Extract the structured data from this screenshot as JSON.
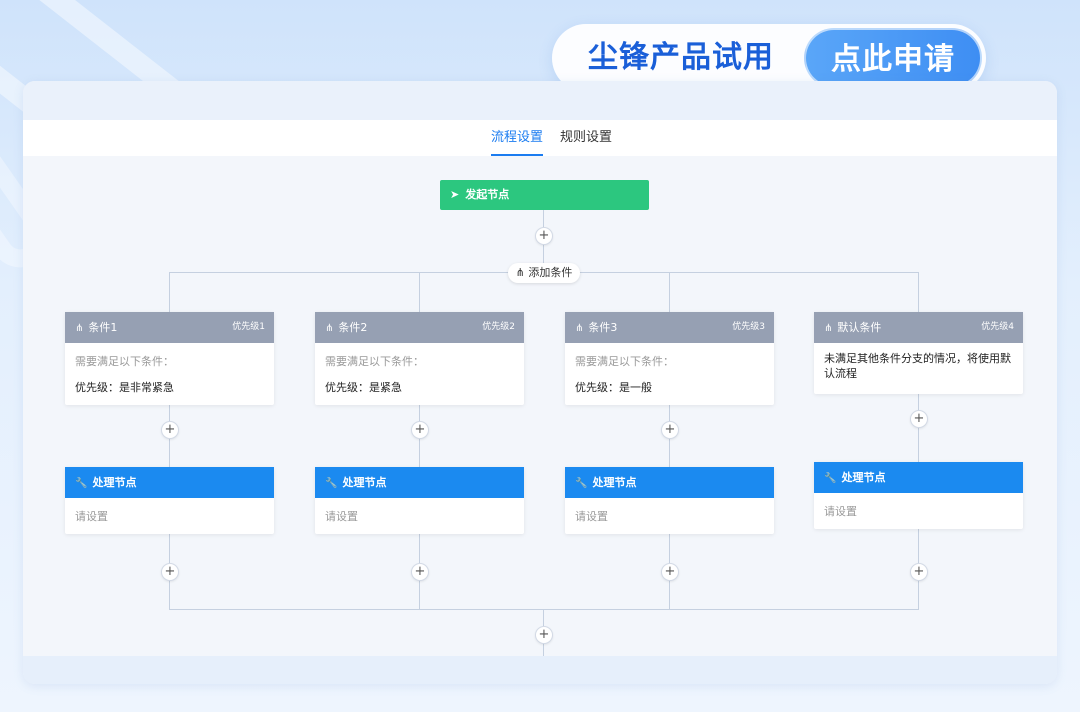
{
  "banner": {
    "text": "尘锋产品试用",
    "button": "点此申请"
  },
  "tabs": [
    {
      "label": "流程设置",
      "active": true
    },
    {
      "label": "规则设置",
      "active": false
    }
  ],
  "flow": {
    "start_label": "发起节点",
    "add_condition_label": "添加条件",
    "plus": "+",
    "conditions": [
      {
        "title": "条件1",
        "priority": "优先级1",
        "sub": "需要满足以下条件：",
        "main": "优先级：是非常紧急"
      },
      {
        "title": "条件2",
        "priority": "优先级2",
        "sub": "需要满足以下条件：",
        "main": "优先级：是紧急"
      },
      {
        "title": "条件3",
        "priority": "优先级3",
        "sub": "需要满足以下条件：",
        "main": "优先级：是一般"
      },
      {
        "title": "默认条件",
        "priority": "优先级4",
        "sub": "",
        "main": "未满足其他条件分支的情况，将使用默认流程"
      }
    ],
    "process": [
      {
        "title": "处理节点",
        "hint": "请设置"
      },
      {
        "title": "处理节点",
        "hint": "请设置"
      },
      {
        "title": "处理节点",
        "hint": "请设置"
      },
      {
        "title": "处理节点",
        "hint": "请设置"
      }
    ]
  },
  "colors": {
    "accent": "#1b7cf0",
    "start_node": "#2cc77f",
    "condition_head": "#96a0b3",
    "process_head": "#1b8af0"
  }
}
